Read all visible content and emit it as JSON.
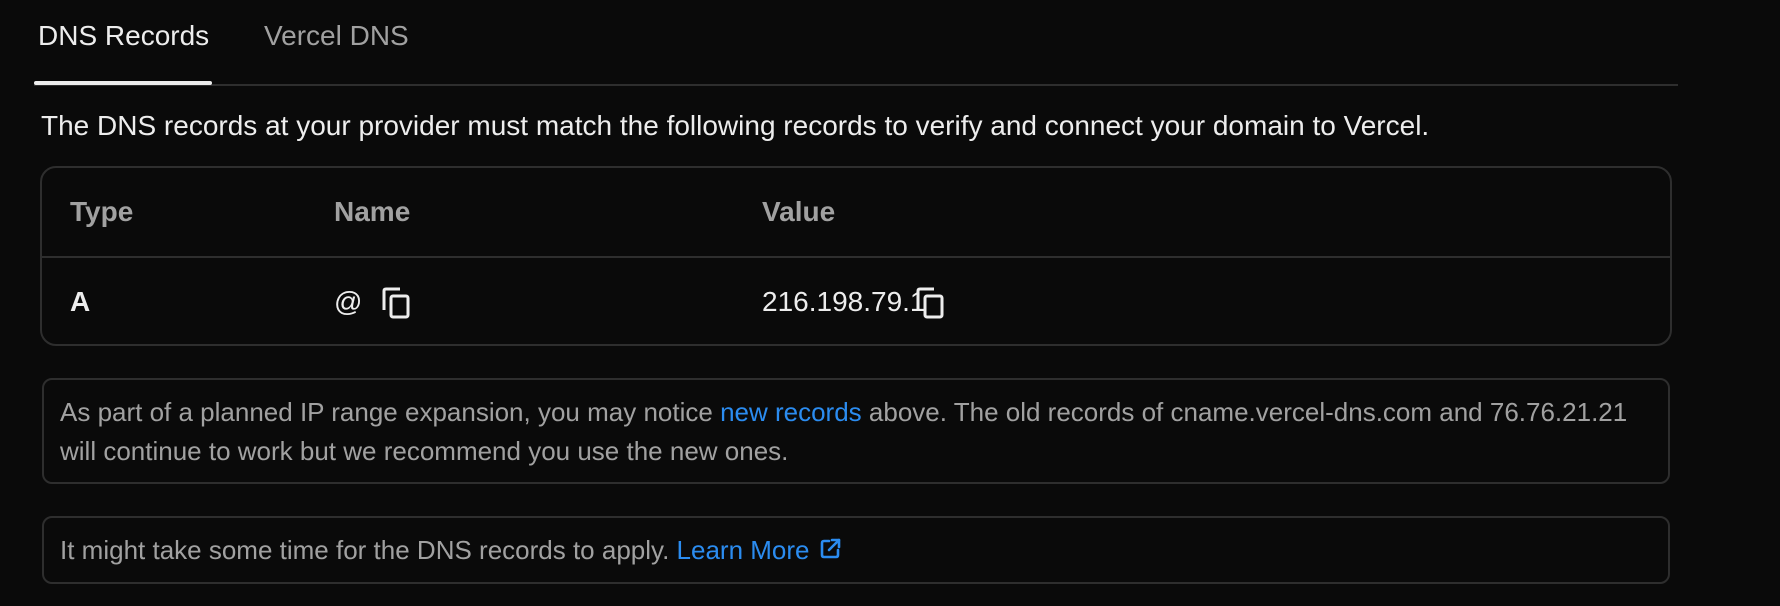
{
  "tabs": [
    {
      "label": "DNS Records",
      "active": true
    },
    {
      "label": "Vercel DNS",
      "active": false
    }
  ],
  "intro": "The DNS records at your provider must match the following records to verify and connect your domain to Vercel.",
  "records_table": {
    "headers": {
      "type": "Type",
      "name": "Name",
      "value": "Value"
    },
    "rows": [
      {
        "type": "A",
        "name": "@",
        "value": "216.198.79.1"
      }
    ]
  },
  "notice_expansion": {
    "text_before": "As part of a planned IP range expansion, you may notice ",
    "link": "new records",
    "text_after_line1": " above. The old records of cname.vercel-dns.com and 76.76.21.21",
    "text_line2": "will continue to work but we recommend you use the new ones."
  },
  "notice_propagation": {
    "text": "It might take some time for the DNS records to apply. ",
    "link": "Learn More"
  },
  "icons": {
    "copy": "copy-icon",
    "external": "external-link-icon"
  },
  "colors": {
    "background": "#0a0a0a",
    "text": "#ededed",
    "muted": "#a1a1a1",
    "border": "#2e2e2e",
    "link": "#2b8cf0"
  }
}
